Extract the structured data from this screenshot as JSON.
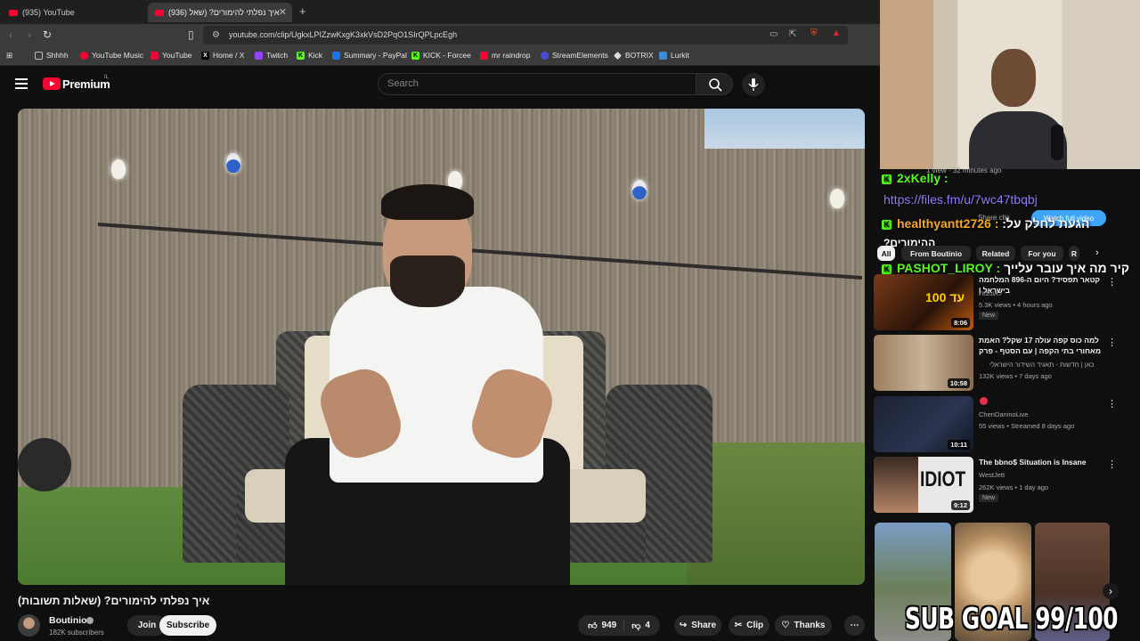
{
  "browser": {
    "tabs": [
      {
        "label": "(935) YouTube"
      },
      {
        "label": "(936) איך נפלתי להימורים? (שאל"
      }
    ],
    "new_tab": "+",
    "url": "youtube.com/clip/UgkxLPIZzwKxgK3xkVsD2PqO1SIrQPLpcEgh",
    "bookmarks": [
      {
        "label": "Shhhh",
        "icon": "folder-icon",
        "color": "#bbbbbb"
      },
      {
        "label": "YouTube Music",
        "icon": "youtube-music-icon",
        "color": "#ff0033"
      },
      {
        "label": "YouTube",
        "icon": "youtube-icon",
        "color": "#ff0033"
      },
      {
        "label": "Home / X",
        "icon": "x-icon",
        "color": "#000000"
      },
      {
        "label": "Twitch",
        "icon": "twitch-icon",
        "color": "#9146ff"
      },
      {
        "label": "Kick",
        "icon": "kick-icon",
        "color": "#53fc18"
      },
      {
        "label": "Summary - PayPal",
        "icon": "paypal-icon",
        "color": "#1a73e8"
      },
      {
        "label": "KICK - Forcee",
        "icon": "kick-icon",
        "color": "#53fc18"
      },
      {
        "label": "mr raindrop",
        "icon": "youtube-icon",
        "color": "#ff0033"
      },
      {
        "label": "StreamElements",
        "icon": "streamelements-icon",
        "color": "#4b4bd8"
      },
      {
        "label": "BOTRIX",
        "icon": "botrix-icon",
        "color": "#dddddd"
      },
      {
        "label": "Lurkit",
        "icon": "lurkit-icon",
        "color": "#3a8bd8"
      }
    ]
  },
  "youtube": {
    "brand": "Premium",
    "brand_region": "IL",
    "search_placeholder": "Search"
  },
  "video": {
    "title": "איך נפלתי להימורים? (שאלות תשובות)",
    "channel": "Boutinio",
    "subscribers": "182K subscribers",
    "join_label": "Join",
    "subscribe_label": "Subscribe",
    "likes": "949",
    "dislikes": "4",
    "share_label": "Share",
    "clip_label": "Clip",
    "thanks_label": "Thanks"
  },
  "stream_overlay": {
    "chat": [
      {
        "user": "2xKelly :",
        "color": "#53fc18",
        "message": ""
      },
      {
        "user": "",
        "color": "#8e7dff",
        "message": "https://files.fm/u/7wc47tbqbj"
      },
      {
        "user": "healthyantt2726 :",
        "color": "#f5a623",
        "message": "הגעת לחלק על:"
      },
      {
        "user": "",
        "color": "#ffffff",
        "message": "ההימורים?"
      },
      {
        "user": "PASHOT_LIROY :",
        "color": "#53fc18",
        "message": "קיר מה איך עובר עלייך"
      }
    ],
    "behind_text": "1 view · 32 minutes ago",
    "watch_full_video": "Watch full video",
    "share_clip": "Share clip",
    "sub_goal": "SUB GOAL 99/100"
  },
  "filters": {
    "chips": [
      "All",
      "From Boutinio",
      "Related",
      "For you",
      "R"
    ]
  },
  "recommendations": [
    {
      "title": "קטאר תפסיד? היום ה-896 המלחמה בישראל |",
      "channel": "לאומנות",
      "meta": "5.3K views • 4 hours ago",
      "badge": "New",
      "duration": "8:06",
      "thumb_bg": "#5a2a14"
    },
    {
      "title": "למה כוס קפה עולה 17 שקל? האמת מאחורי בתי הקפה | עם הסטף - פרק",
      "channel": "כאן | חדשות - תאגיד השידור הישראלי",
      "meta": "132K views • 7 days ago",
      "badge": "",
      "duration": "10:58",
      "thumb_bg": "#8a6a4e"
    },
    {
      "title": "",
      "channel": "ChenDaninoLive",
      "meta": "55 views • Streamed 8 days ago",
      "badge": "",
      "duration": "10:11",
      "thumb_bg": "#1c2233"
    },
    {
      "title": "The bbno$ Situation is Insane",
      "channel": "WestJett",
      "meta": "262K views • 1 day ago",
      "badge": "New",
      "duration": "9:12",
      "thumb_bg": "#e4e4e4",
      "thumb_text": "IDIOT"
    }
  ]
}
